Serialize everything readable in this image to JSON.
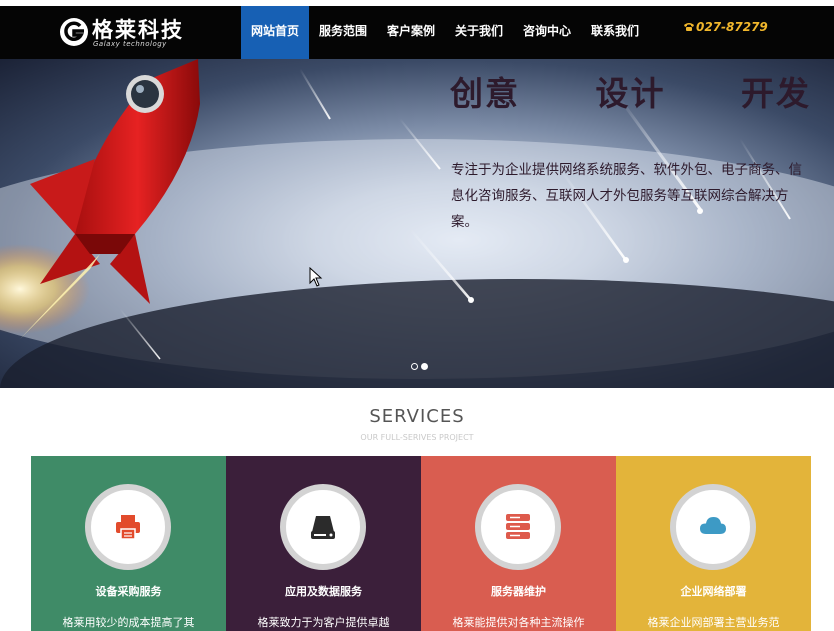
{
  "brand": {
    "name": "格莱科技",
    "subtitle": "Galaxy technology"
  },
  "nav": {
    "items": [
      "网站首页",
      "服务范围",
      "客户案例",
      "关于我们",
      "咨询中心",
      "联系我们"
    ],
    "active_index": 0,
    "phone": "027-87279"
  },
  "hero": {
    "headline": "创意 设计 开发",
    "description": "专注于为企业提供网络系统服务、软件外包、电子商务、信息化咨询服务、互联网人才外包服务等互联网综合解决方案。",
    "slide_count": 2,
    "active_slide": 1
  },
  "services": {
    "title": "SERVICES",
    "subtitle": "OUR FULL-SERIVES PROJECT",
    "cards": [
      {
        "title": "设备采购服务",
        "text": "格莱用较少的成本提高了其",
        "color": "#3f8b67",
        "icon_color": "#e24b2c",
        "icon": "printer-icon"
      },
      {
        "title": "应用及数据服务",
        "text": "格莱致力于为客户提供卓越",
        "color": "#3b1f3a",
        "icon_color": "#2b2b2b",
        "icon": "hard-drive-icon"
      },
      {
        "title": "服务器维护",
        "text": "格莱能提供对各种主流操作",
        "color": "#d95d50",
        "icon_color": "#de5a4c",
        "icon": "server-icon"
      },
      {
        "title": "企业网络部署",
        "text": "格莱企业网部署主营业务范",
        "color": "#e3b43a",
        "icon_color": "#3d9ac5",
        "icon": "cloud-icon"
      }
    ]
  },
  "colors": {
    "navbar": "#050505",
    "nav_active": "#1760b4",
    "phone": "#f1b72c"
  }
}
